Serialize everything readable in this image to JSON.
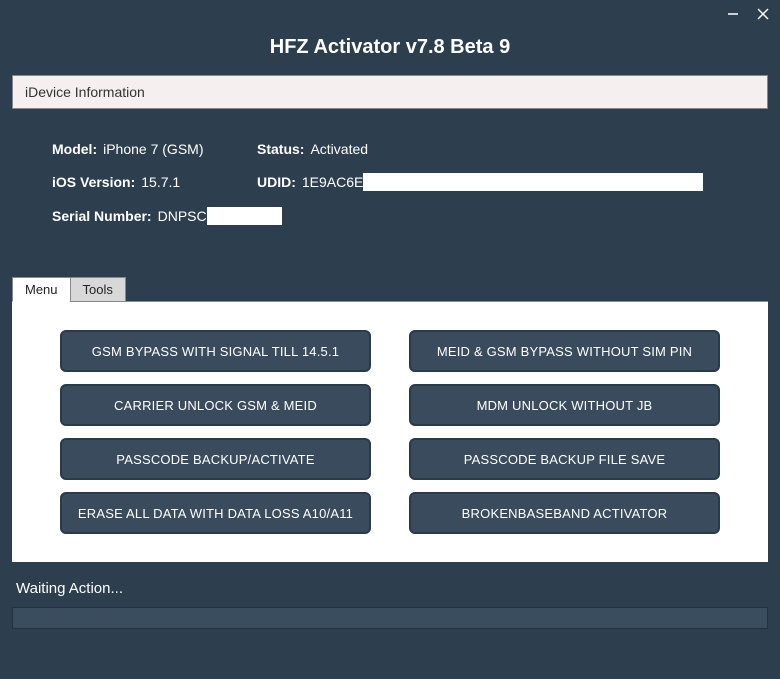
{
  "app": {
    "title": "HFZ Activator v7.8 Beta 9"
  },
  "infoPanel": {
    "title": "iDevice Information"
  },
  "device": {
    "modelLabel": "Model:",
    "modelValue": "iPhone 7 (GSM)",
    "statusLabel": "Status:",
    "statusValue": "Activated",
    "iosLabel": "iOS Version:",
    "iosValue": "15.7.1",
    "udidLabel": "UDID:",
    "udidValue": "1E9AC6E",
    "serialLabel": "Serial Number:",
    "serialValue": "DNPSC"
  },
  "tabs": {
    "menu": "Menu",
    "tools": "Tools"
  },
  "actions": {
    "btn1": "GSM BYPASS WITH SIGNAL TILL 14.5.1",
    "btn2": "MEID & GSM BYPASS WITHOUT SIM PIN",
    "btn3": "CARRIER UNLOCK GSM & MEID",
    "btn4": "MDM UNLOCK WITHOUT JB",
    "btn5": "PASSCODE BACKUP/ACTIVATE",
    "btn6": "PASSCODE BACKUP FILE SAVE",
    "btn7": "ERASE ALL DATA WITH DATA LOSS A10/A11",
    "btn8": "BROKENBASEBAND ACTIVATOR"
  },
  "status": {
    "text": "Waiting Action..."
  }
}
